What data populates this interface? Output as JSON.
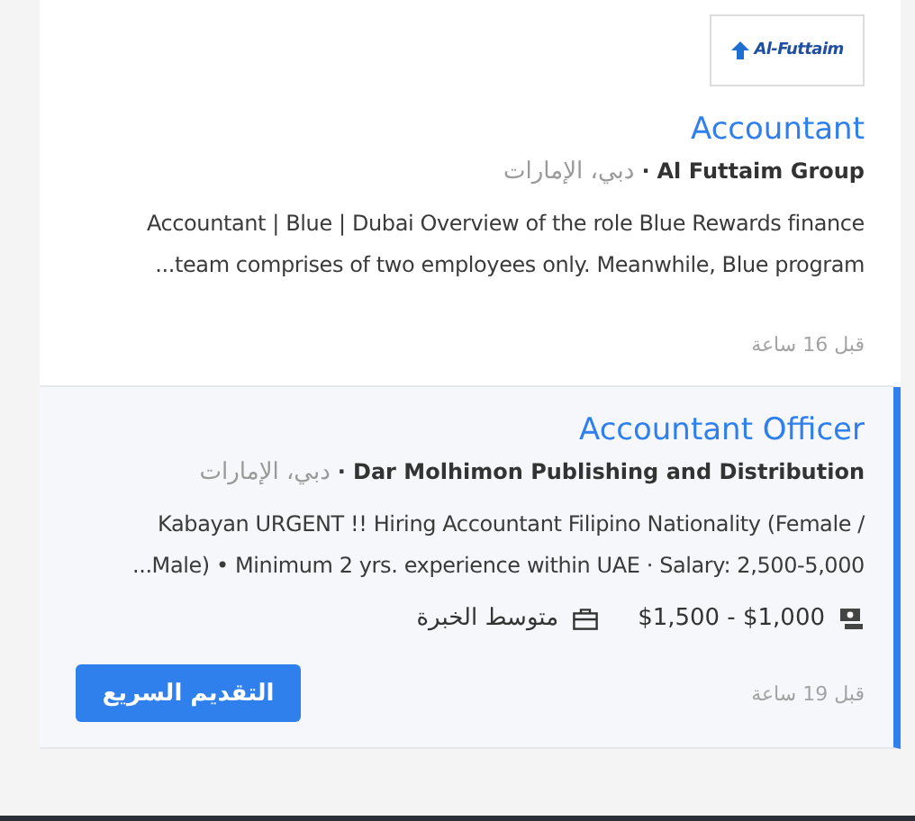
{
  "jobs": [
    {
      "selected": false,
      "logo_text": "Al-Futtaim",
      "title": "Accountant",
      "company": "Al Futtaim Group",
      "separator": "·",
      "location": "دبي، الإمارات",
      "description": [
        "Accountant | Blue | Dubai Overview of the role Blue Rewards finance",
        "...team comprises of two employees only. Meanwhile, Blue program"
      ],
      "posted": "قبل 16 ساعة"
    },
    {
      "selected": true,
      "title": "Accountant Officer",
      "company": "Dar Molhimon Publishing and Distribution",
      "separator": "·",
      "location": "دبي، الإمارات",
      "description": [
        "Kabayan URGENT !! Hiring Accountant Filipino Nationality (Female /",
        "...Male) • Minimum 2 yrs. experience within UAE · Salary: 2,500-5,000"
      ],
      "salary": "$1,500 - $1,000",
      "experience": "متوسط الخبرة",
      "apply_button": "التقديم السريع",
      "posted": "قبل 19 ساعة"
    }
  ]
}
